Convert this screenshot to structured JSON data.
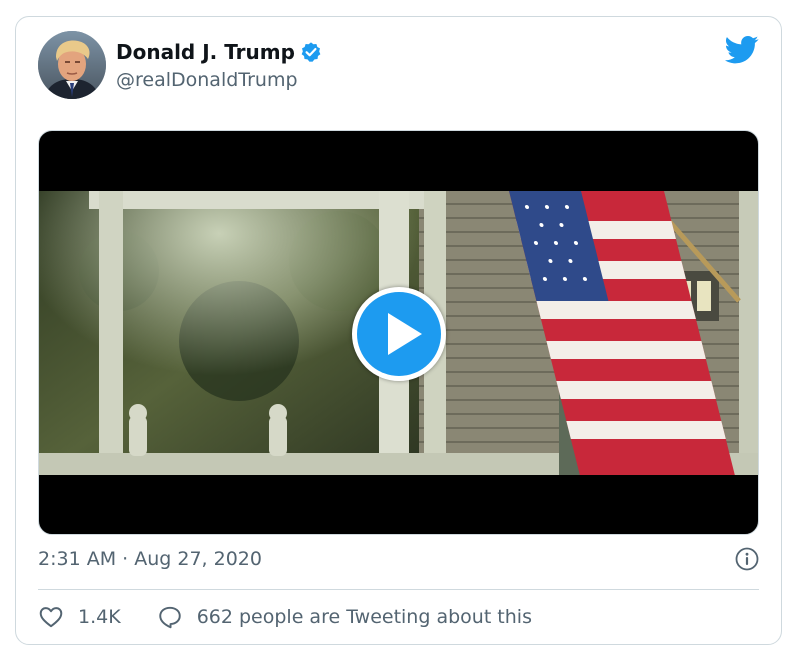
{
  "tweet": {
    "display_name": "Donald J. Trump",
    "handle": "@realDonaldTrump",
    "timestamp": "2:31 AM · Aug 27, 2020",
    "likes": "1.4K",
    "tweeting_text": "662 people are Tweeting about this"
  },
  "icons": {
    "verified": "verified-badge-icon",
    "brand": "twitter-bird-icon",
    "play": "play-icon",
    "info": "info-icon",
    "like": "heart-icon",
    "reply": "speech-bubble-icon"
  },
  "colors": {
    "accent": "#1d9bf0",
    "text_primary": "#0f1419",
    "text_secondary": "#536471",
    "border": "#cfd9de"
  }
}
